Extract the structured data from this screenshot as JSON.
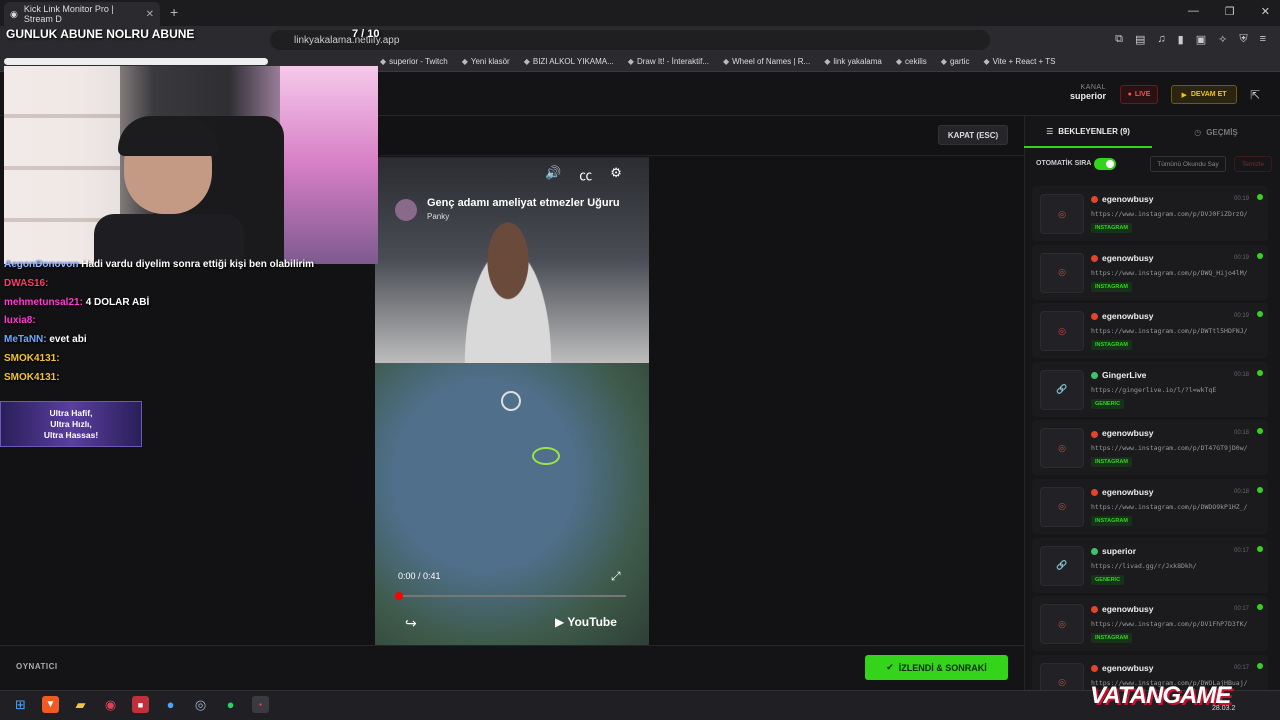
{
  "browser": {
    "tab_title": "Kick Link Monitor Pro | Stream D",
    "url": "linkyakalama.netlify.app",
    "bookmarks": [
      "superior - Twitch",
      "Yeni klasör",
      "BIZI ALKOL YIKAMA...",
      "Draw It! - İnteraktif...",
      "Wheel of Names | R...",
      "link yakalama",
      "cekilis",
      "gartic",
      "Vite + React + TS"
    ]
  },
  "overlay": {
    "title": "GUNLUK ABUNE NOLRU ABUNE",
    "counter": "7 / 10",
    "banner": [
      "Ultra Hafif,",
      "Ultra Hızlı,",
      "Ultra Hassas!"
    ]
  },
  "chat": [
    {
      "user": "AegonDonovon",
      "msg": "Hadi vardu diyelim sonra ettiği kişi ben olabilirim",
      "color": "#9ab7ff"
    },
    {
      "user": "DWAS16:",
      "msg": "",
      "color": "#ff3b6b"
    },
    {
      "user": "mehmetunsal21:",
      "msg": "4 DOLAR ABİ",
      "color": "#ff3bd1"
    },
    {
      "user": "luxia8:",
      "msg": "",
      "color": "#ff3bd1"
    },
    {
      "user": "MeTaNN:",
      "msg": "evet abi",
      "color": "#6aa8ff"
    },
    {
      "user": "SMOK4131:",
      "msg": "",
      "color": "#f2c230"
    },
    {
      "user": "SMOK4131:",
      "msg": "",
      "color": "#f2c230"
    }
  ],
  "header": {
    "kanal_label": "KANAL",
    "kanal_value": "superior",
    "live_label": "LIVE",
    "devam_label": "DEVAM ET"
  },
  "player": {
    "close_label": "KAPAT (ESC)",
    "video_title": "Genç adamı ameliyat etmezler Uğuru",
    "video_channel": "Panky",
    "time": "0:00 / 0:41",
    "progress": 0.0,
    "yt_label": "YouTube",
    "footer_label": "OYNATICI",
    "next_label": "İZLENDİ & SONRAKİ"
  },
  "panel": {
    "tab_waiting": "BEKLEYENLER (9)",
    "tab_history": "GEÇMİŞ",
    "auto_label": "OTOMATİK SIRA",
    "auto_on": true,
    "mark_all": "Tümünü Okundu Say",
    "clear": "Temizle",
    "queue": [
      {
        "user": "egenowbusy",
        "url": "https://www.instagram.com/p/DVJ0FiZDrzO/",
        "tag": "INSTAGRAM",
        "time": "00:19"
      },
      {
        "user": "egenowbusy",
        "url": "https://www.instagram.com/p/DWQ_Hijo4lM/",
        "tag": "INSTAGRAM",
        "time": "00:19"
      },
      {
        "user": "egenowbusy",
        "url": "https://www.instagram.com/p/DWTtl5HDFNJ/",
        "tag": "INSTAGRAM",
        "time": "00:19"
      },
      {
        "user": "GingerLive",
        "url": "https://gingerlive.io/l/?l=wkTqE",
        "tag": "GENERIC",
        "time": "00:18"
      },
      {
        "user": "egenowbusy",
        "url": "https://www.instagram.com/p/DT47GT9jD0w/",
        "tag": "INSTAGRAM",
        "time": "00:18"
      },
      {
        "user": "egenowbusy",
        "url": "https://www.instagram.com/p/DWDO9kP1HZ_/",
        "tag": "INSTAGRAM",
        "time": "00:18"
      },
      {
        "user": "superior",
        "url": "https://livad.gg/r/Jxk8Dkh/",
        "tag": "GENERIC",
        "time": "00:17"
      },
      {
        "user": "egenowbusy",
        "url": "https://www.instagram.com/p/DV1FhP7D3fK/",
        "tag": "INSTAGRAM",
        "time": "00:17"
      },
      {
        "user": "egenowbusy",
        "url": "https://www.instagram.com/p/DWOLajHBuaj/",
        "tag": "INSTAGRAM",
        "time": "00:17"
      }
    ]
  },
  "watermark": {
    "brand": "VATANGAME",
    "date": "28.03.2"
  },
  "colors": {
    "accent_green": "#34d41a",
    "live_red": "#ff4d4d",
    "devam_yellow": "#f0c419"
  }
}
